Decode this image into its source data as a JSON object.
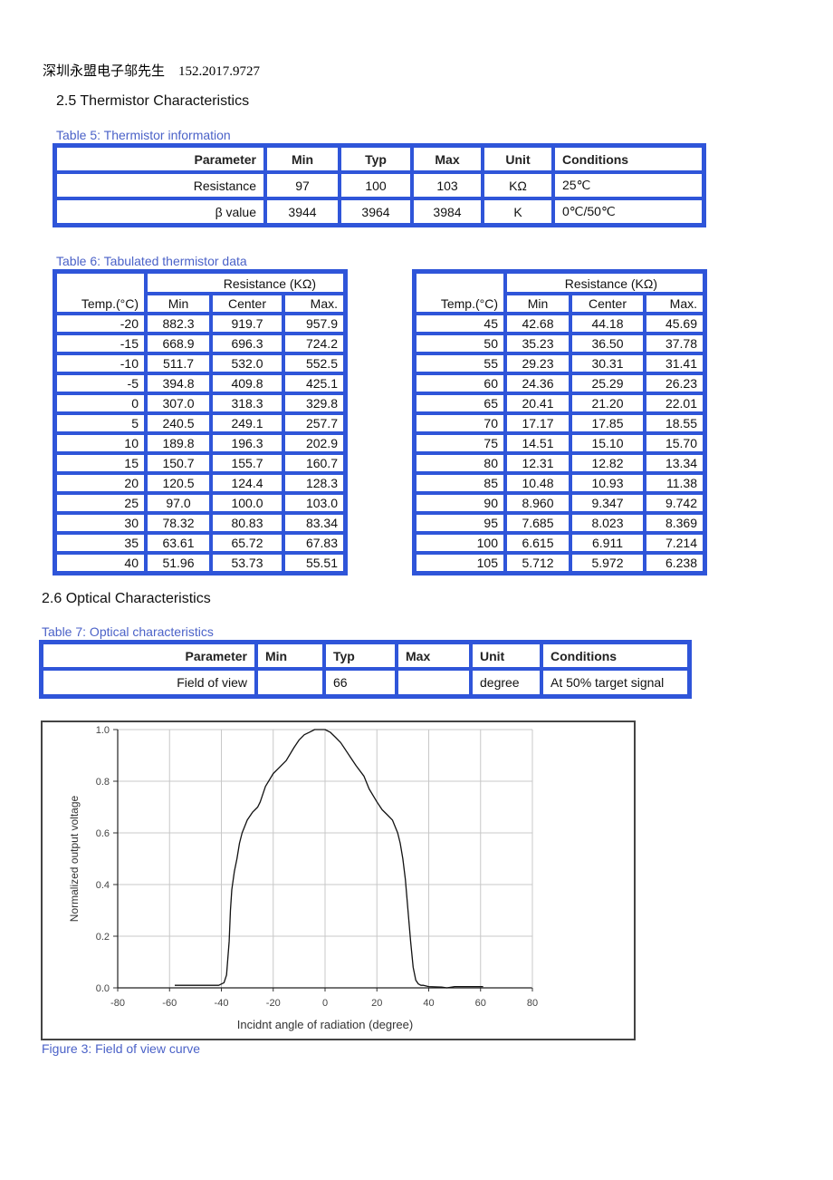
{
  "header": {
    "contact": "深圳永盟电子邬先生    152.2017.9727"
  },
  "section_25": {
    "title": "2.5  Thermistor Characteristics",
    "table5": {
      "caption": "Table 5: Thermistor information",
      "headers": [
        "Parameter",
        "Min",
        "Typ",
        "Max",
        "Unit",
        "Conditions"
      ],
      "rows": [
        [
          "Resistance",
          "97",
          "100",
          "103",
          "KΩ",
          "25℃"
        ],
        [
          "β  value",
          "3944",
          "3964",
          "3984",
          "K",
          "0℃/50℃"
        ]
      ]
    },
    "table6": {
      "caption": "Table 6: Tabulated thermistor data",
      "group_header": "Resistance (KΩ)",
      "temp_header": "Temp.(°C)",
      "sub_headers": [
        "Min",
        "Center",
        "Max."
      ],
      "left_rows": [
        [
          "-20",
          "882.3",
          "919.7",
          "957.9"
        ],
        [
          "-15",
          "668.9",
          "696.3",
          "724.2"
        ],
        [
          "-10",
          "511.7",
          "532.0",
          "552.5"
        ],
        [
          "-5",
          "394.8",
          "409.8",
          "425.1"
        ],
        [
          "0",
          "307.0",
          "318.3",
          "329.8"
        ],
        [
          "5",
          "240.5",
          "249.1",
          "257.7"
        ],
        [
          "10",
          "189.8",
          "196.3",
          "202.9"
        ],
        [
          "15",
          "150.7",
          "155.7",
          "160.7"
        ],
        [
          "20",
          "120.5",
          "124.4",
          "128.3"
        ],
        [
          "25",
          "97.0",
          "100.0",
          "103.0"
        ],
        [
          "30",
          "78.32",
          "80.83",
          "83.34"
        ],
        [
          "35",
          "63.61",
          "65.72",
          "67.83"
        ],
        [
          "40",
          "51.96",
          "53.73",
          "55.51"
        ]
      ],
      "right_rows": [
        [
          "45",
          "42.68",
          "44.18",
          "45.69"
        ],
        [
          "50",
          "35.23",
          "36.50",
          "37.78"
        ],
        [
          "55",
          "29.23",
          "30.31",
          "31.41"
        ],
        [
          "60",
          "24.36",
          "25.29",
          "26.23"
        ],
        [
          "65",
          "20.41",
          "21.20",
          "22.01"
        ],
        [
          "70",
          "17.17",
          "17.85",
          "18.55"
        ],
        [
          "75",
          "14.51",
          "15.10",
          "15.70"
        ],
        [
          "80",
          "12.31",
          "12.82",
          "13.34"
        ],
        [
          "85",
          "10.48",
          "10.93",
          "11.38"
        ],
        [
          "90",
          "8.960",
          "9.347",
          "9.742"
        ],
        [
          "95",
          "7.685",
          "8.023",
          "8.369"
        ],
        [
          "100",
          "6.615",
          "6.911",
          "7.214"
        ],
        [
          "105",
          "5.712",
          "5.972",
          "6.238"
        ]
      ]
    }
  },
  "section_26": {
    "title": "2.6  Optical Characteristics",
    "table7": {
      "caption": "Table 7: Optical characteristics",
      "headers": [
        "Parameter",
        "Min",
        "Typ",
        "Max",
        "Unit",
        "Conditions"
      ],
      "rows": [
        [
          "Field of view",
          "",
          "66",
          "",
          "degree",
          "At 50% target signal"
        ]
      ]
    },
    "figure_caption": "Figure 3: Field of view curve"
  },
  "chart_data": {
    "type": "line",
    "title": "",
    "xlabel": "Incidnt angle of radiation (degree)",
    "ylabel": "Normalized output voltage",
    "xlim": [
      -80,
      80
    ],
    "ylim": [
      0,
      1.0
    ],
    "x_ticks": [
      "-80",
      "-60",
      "-40",
      "-20",
      "0",
      "20",
      "40",
      "60",
      "80"
    ],
    "y_ticks": [
      "0.0",
      "0.2",
      "0.4",
      "0.6",
      "0.8",
      "1.0"
    ],
    "grid": true,
    "legend": "none",
    "series": [
      {
        "name": "Field of view",
        "x": [
          -58,
          -45,
          -41,
          -39,
          -38,
          -37,
          -36.5,
          -36,
          -35,
          -34,
          -33,
          -32,
          -30,
          -28,
          -26,
          -25,
          -23,
          -20,
          -18,
          -15,
          -12,
          -10,
          -8,
          -6,
          -4,
          -2,
          0,
          2,
          4,
          6,
          8,
          10,
          12,
          15,
          17,
          20,
          22,
          24,
          26,
          28,
          29,
          30,
          31,
          32,
          33,
          34,
          35,
          36,
          37,
          38,
          40,
          45,
          47,
          50,
          55,
          61
        ],
        "values": [
          0.01,
          0.01,
          0.01,
          0.02,
          0.05,
          0.18,
          0.3,
          0.38,
          0.45,
          0.5,
          0.56,
          0.6,
          0.65,
          0.68,
          0.7,
          0.72,
          0.78,
          0.83,
          0.85,
          0.88,
          0.93,
          0.96,
          0.98,
          0.99,
          1.0,
          1.0,
          1.0,
          0.99,
          0.97,
          0.95,
          0.92,
          0.89,
          0.86,
          0.82,
          0.77,
          0.72,
          0.69,
          0.67,
          0.65,
          0.6,
          0.56,
          0.5,
          0.42,
          0.3,
          0.18,
          0.08,
          0.03,
          0.015,
          0.01,
          0.01,
          0.005,
          0.003,
          0.0,
          0.005,
          0.005,
          0.005
        ]
      }
    ]
  }
}
